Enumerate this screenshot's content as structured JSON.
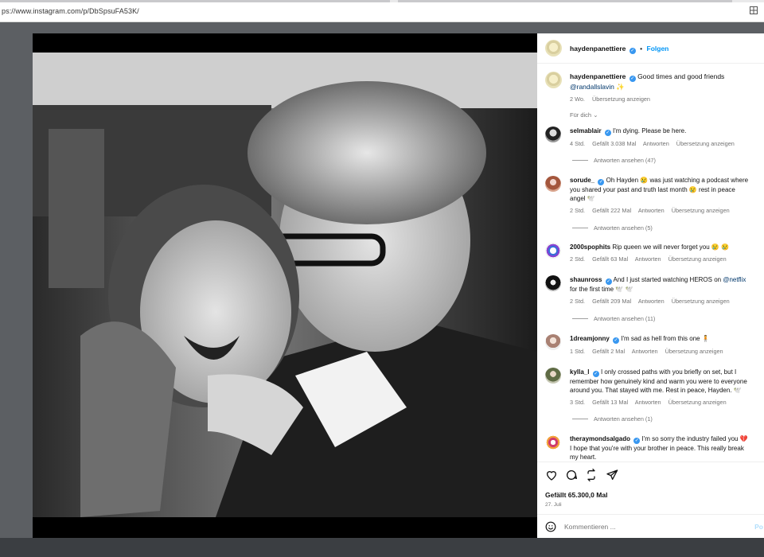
{
  "browser": {
    "url": "ps://www.instagram.com/p/DbSpsuFA53K/"
  },
  "post": {
    "author": "haydenpanettiere",
    "follow_label": "Folgen",
    "separator": "•",
    "caption_text": "Good times and good friends",
    "caption_mention": "@randallslavin",
    "caption_emoji": "✨",
    "caption_age": "2 Wo.",
    "caption_translate": "Übersetzung anzeigen",
    "filter_label": "Für dich",
    "likes": "Gefällt 65.300,0 Mal",
    "date": "27. Juli",
    "add_comment_placeholder": "Kommentieren ...",
    "post_label": "Po"
  },
  "comments": [
    {
      "user": "selmablair",
      "verified": true,
      "text": "I'm dying. Please be here.",
      "age": "4 Std.",
      "likes": "Gefällt 3.038 Mal",
      "reply": "Antworten",
      "translate": "Übersetzung anzeigen",
      "replies": "Antworten ansehen (47)"
    },
    {
      "user": "sorude_",
      "verified": true,
      "text_1": "Oh Hayden 😢 was just watching a podcast where",
      "text_2": "you shared your past and truth last month 😢 rest in peace",
      "text_3": "angel 🕊️",
      "age": "2 Std.",
      "likes": "Gefällt 222 Mal",
      "reply": "Antworten",
      "translate": "Übersetzung anzeigen",
      "replies": "Antworten ansehen (5)"
    },
    {
      "user": "2000spophits",
      "verified": false,
      "text": "Rip queen we will never forget you 😢 😢",
      "age": "2 Std.",
      "likes": "Gefällt 63 Mal",
      "reply": "Antworten",
      "translate": "Übersetzung anzeigen"
    },
    {
      "user": "shaunross",
      "verified": true,
      "text_1": "And I just started watching HEROS on",
      "mention": "@netflix",
      "text_2": "for the first time 🕊️ 🕊️",
      "age": "2 Std.",
      "likes": "Gefällt 209 Mal",
      "reply": "Antworten",
      "translate": "Übersetzung anzeigen",
      "replies": "Antworten ansehen (11)"
    },
    {
      "user": "1dreamjonny",
      "verified": true,
      "text": "I'm sad as hell from this one 🧍",
      "age": "1 Std.",
      "likes": "Gefällt 2 Mal",
      "reply": "Antworten",
      "translate": "Übersetzung anzeigen"
    },
    {
      "user": "kylla_l",
      "verified": true,
      "text_1": "I only crossed paths with you briefly on set, but I",
      "text_2": "remember how genuinely kind and warm you were to everyone",
      "text_3": "around you. That stayed with me. Rest in peace, Hayden. 🕊️",
      "age": "3 Std.",
      "likes": "Gefällt 13 Mal",
      "reply": "Antworten",
      "translate": "Übersetzung anzeigen",
      "replies": "Antworten ansehen (1)"
    },
    {
      "user": "theraymondsalgado",
      "verified": true,
      "text_1": "I'm so sorry the industry failed you 💔",
      "text_2": "I hope that you're with your brother in peace. This really break",
      "text_3": "my heart."
    }
  ],
  "icons": [
    "heart-icon",
    "comment-icon",
    "repost-icon",
    "share-icon",
    "emoji-icon",
    "verified-icon",
    "chevron-down-icon",
    "tab-grid-icon"
  ],
  "colors": {
    "verified": "#3897f0",
    "follow": "#0095f6",
    "muted": "#737373",
    "mention": "#00376b",
    "photo_bg": "#000000"
  }
}
